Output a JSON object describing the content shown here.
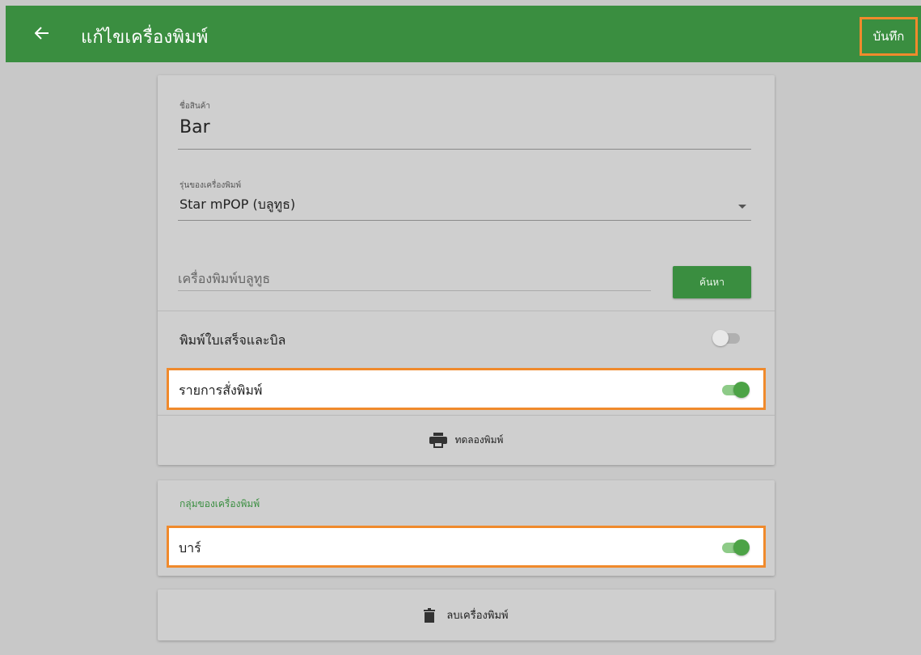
{
  "header": {
    "title": "แก้ไขเครื่องพิมพ์",
    "save_label": "บันทึก",
    "back_icon": "arrow-left-icon"
  },
  "form": {
    "name_label": "ชื่อสินค้า",
    "name_value": "Bar",
    "model_label": "รุ่นของเครื่องพิมพ์",
    "model_value": "Star mPOP (บลูทูธ)",
    "bluetooth_placeholder": "เครื่องพิมพ์บลูทูธ",
    "search_label": "ค้นหา"
  },
  "toggles": {
    "receipt_label": "พิมพ์ใบเสร็จและบิล",
    "receipt_on": false,
    "order_label": "รายการสั่งพิมพ์",
    "order_on": true
  },
  "test_print": {
    "label": "ทดลองพิมพ์",
    "icon": "printer-icon"
  },
  "group": {
    "title": "กลุ่มของเครื่องพิมพ์",
    "items": [
      {
        "label": "บาร์",
        "on": true
      }
    ]
  },
  "delete": {
    "label": "ลบเครื่องพิมพ์",
    "icon": "trash-icon"
  },
  "colors": {
    "primary": "#3a8e40",
    "highlight": "#f08a2c",
    "toggle_on": "#4ca346"
  }
}
